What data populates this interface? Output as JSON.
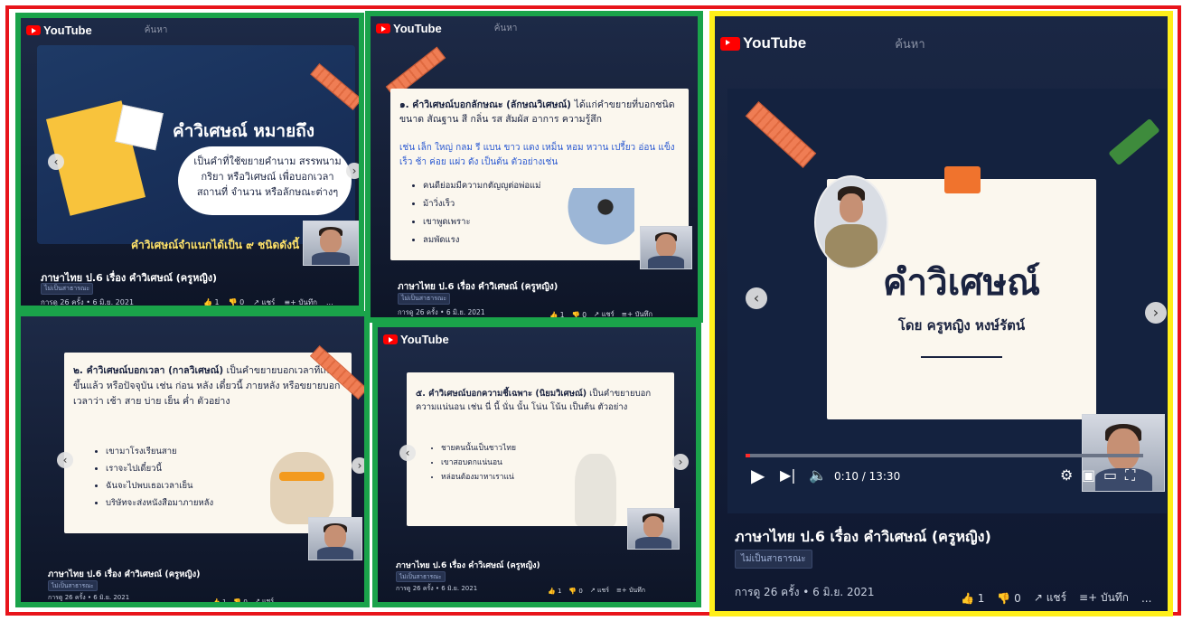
{
  "youtube": {
    "logo": "YouTube",
    "search_text": "ค้นหา"
  },
  "video": {
    "title": "ภาษาไทย ป.6 เรื่อง คำวิเศษณ์ (ครูหญิง)",
    "visibility": "ไม่เป็นสาธารณะ",
    "meta": "การดู 26 ครั้ง • 6 มิ.ย. 2021",
    "likes": "1",
    "dislikes": "0",
    "share": "แชร์",
    "save": "บันทึก",
    "more": "..."
  },
  "panel1": {
    "heading": "คำวิเศษณ์ หมายถึง",
    "definition": "เป็นคำที่ใช้ขยายคำนาม สรรพนาม กริยา หรือวิเศษณ์ เพื่อบอกเวลา สถานที่ จำนวน หรือลักษณะต่างๆ",
    "footer": "คำวิเศษณ์จำแนกได้เป็น ๙ ชนิดดังนี้"
  },
  "panel2": {
    "heading": "๑. คำวิเศษณ์บอกลักษณะ (ลักษณวิเศษณ์)",
    "text": "ได้แก่คำขยายที่บอกชนิด ขนาด สัณฐาน สี กลิ่น รส สัมผัส อาการ ความรู้สึก",
    "examples_line": "เช่น เล็ก ใหญ่ กลม รี แบน ขาว แดง เหม็น หอม หวาน เปรี้ยว อ่อน แข็ง เร็ว ช้า ค่อย แผ่ว ดัง เป็นต้น ตัวอย่างเช่น",
    "bullets": [
      "คนดีย่อมมีความกตัญญูต่อพ่อแม่",
      "ม้าวิ่งเร็ว",
      "เขาพูดเพราะ",
      "ลมพัดแรง"
    ]
  },
  "panel3": {
    "heading": "๒. คำวิเศษณ์บอกเวลา (กาลวิเศษณ์)",
    "text": "เป็นคำขยายบอกเวลาที่เกิดขึ้นแล้ว หรือปัจจุบัน เช่น ก่อน หลัง เดี๋ยวนี้ ภายหลัง หรือขยายบอกเวลาว่า เช้า สาย บ่าย เย็น ค่ำ ตัวอย่าง",
    "bullets": [
      "เขามาโรงเรียนสาย",
      "เราจะไปเดี๋ยวนี้",
      "ฉันจะไปพบเธอเวลาเย็น",
      "บริษัทจะส่งหนังสือมาภายหลัง"
    ]
  },
  "panel4": {
    "heading": "๕. คำวิเศษณ์บอกความชี้เฉพาะ (นิยมวิเศษณ์)",
    "text": "เป็นคำขยายบอกความแน่นอน เช่น นี่ นี้ นั่น นั้น โน่น โน้น เป็นต้น ตัวอย่าง",
    "bullets": [
      "ชายคนนั้นเป็นชาวไทย",
      "เขาสอบตกแน่นอน",
      "หล่อนต้องมาหาเราแน่"
    ]
  },
  "panel5": {
    "slide_title": "คำวิเศษณ์",
    "slide_subtitle": "โดย ครูหญิง หงษ์รัตน์",
    "time": "0:10 / 13:30",
    "progress": 0.012
  },
  "colors": {
    "red_frame": "#e8141b",
    "green_frame": "#1aa34a",
    "yellow_frame": "#ffef1a",
    "yt_red": "#ff0000"
  }
}
